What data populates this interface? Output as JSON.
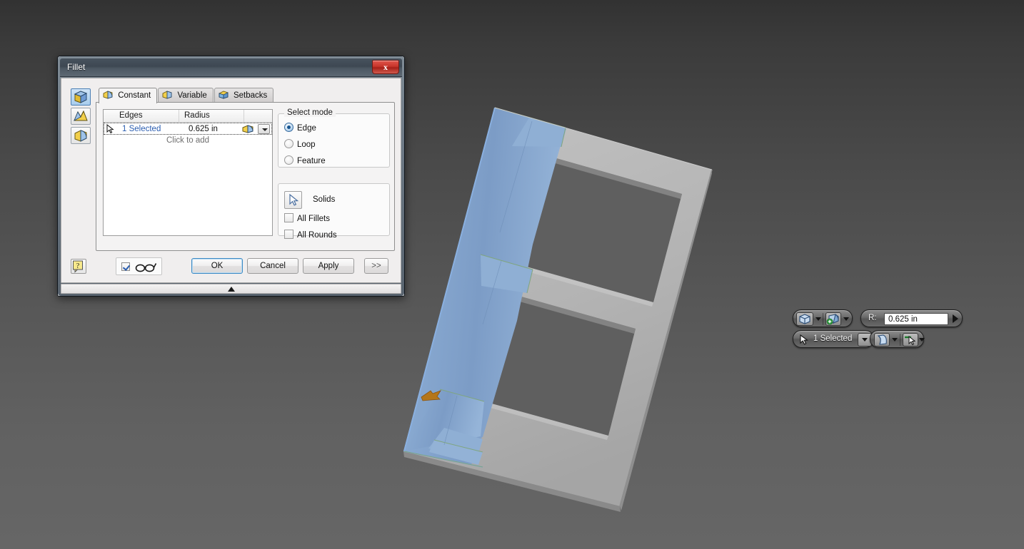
{
  "app": {
    "viewport_bg_top": "#323232",
    "viewport_bg_bottom": "#666666"
  },
  "dialog": {
    "title": "Fillet",
    "close_label": "x",
    "side_tools": [
      {
        "name": "edge-fillet",
        "tooltip": "Edge Fillet",
        "active": true
      },
      {
        "name": "face-fillet",
        "tooltip": "Face Fillet",
        "active": false
      },
      {
        "name": "full-round-fillet",
        "tooltip": "Full Round Fillet",
        "active": false
      }
    ],
    "tabs": [
      {
        "label": "Constant",
        "icon": "fillet-constant-icon",
        "active": true
      },
      {
        "label": "Variable",
        "icon": "fillet-variable-icon",
        "active": false
      },
      {
        "label": "Setbacks",
        "icon": "fillet-setbacks-icon",
        "active": false
      }
    ],
    "edges_table": {
      "headers": [
        "Edges",
        "Radius"
      ],
      "rows": [
        {
          "edges": "1 Selected",
          "radius": "0.625 in"
        }
      ],
      "add_row_label": "Click to add"
    },
    "select_mode": {
      "title": "Select mode",
      "options": [
        {
          "label": "Edge",
          "checked": true
        },
        {
          "label": "Loop",
          "checked": false
        },
        {
          "label": "Feature",
          "checked": false
        }
      ]
    },
    "solids_group": {
      "solids_label": "Solids",
      "checkboxes": [
        {
          "label": "All Fillets",
          "checked": false
        },
        {
          "label": "All Rounds",
          "checked": false
        }
      ]
    },
    "footer": {
      "help_label": "?",
      "preview_checked": true,
      "preview_icon": "glasses-icon",
      "ok": "OK",
      "cancel": "Cancel",
      "apply": "Apply",
      "more": ">>"
    }
  },
  "mini_toolbar": {
    "row1": {
      "solid_button": "solid-body-icon",
      "solid_caret": "chevron-down-icon",
      "add_fillet_button": "add-fillet-icon",
      "add_fillet_caret": "chevron-down-icon",
      "radius_label": "R:",
      "radius_value": "0.625 in",
      "apply_arrow": "play-arrow-icon"
    },
    "row2": {
      "select_icon": "arrow-cursor-icon",
      "selection_text": "1 Selected",
      "selection_caret": "chevron-down-icon",
      "fillet-preview_icon": "fillet-preview-icon",
      "fillet_caret": "chevron-down-icon",
      "edge_select_icon": "edge-select-icon",
      "edge_caret": "chevron-down-icon"
    }
  },
  "model": {
    "description": "Shaded 3D part - rectangular frame with two rectangular windows, rotated; left flange face highlighted blue as selected fillet edge",
    "selected_face_color": "#7d9cc4",
    "body_color": "#b6b6b6",
    "highlight_edge_color": "#8ab0e0",
    "direction_arrow_color": "#b5761a"
  }
}
